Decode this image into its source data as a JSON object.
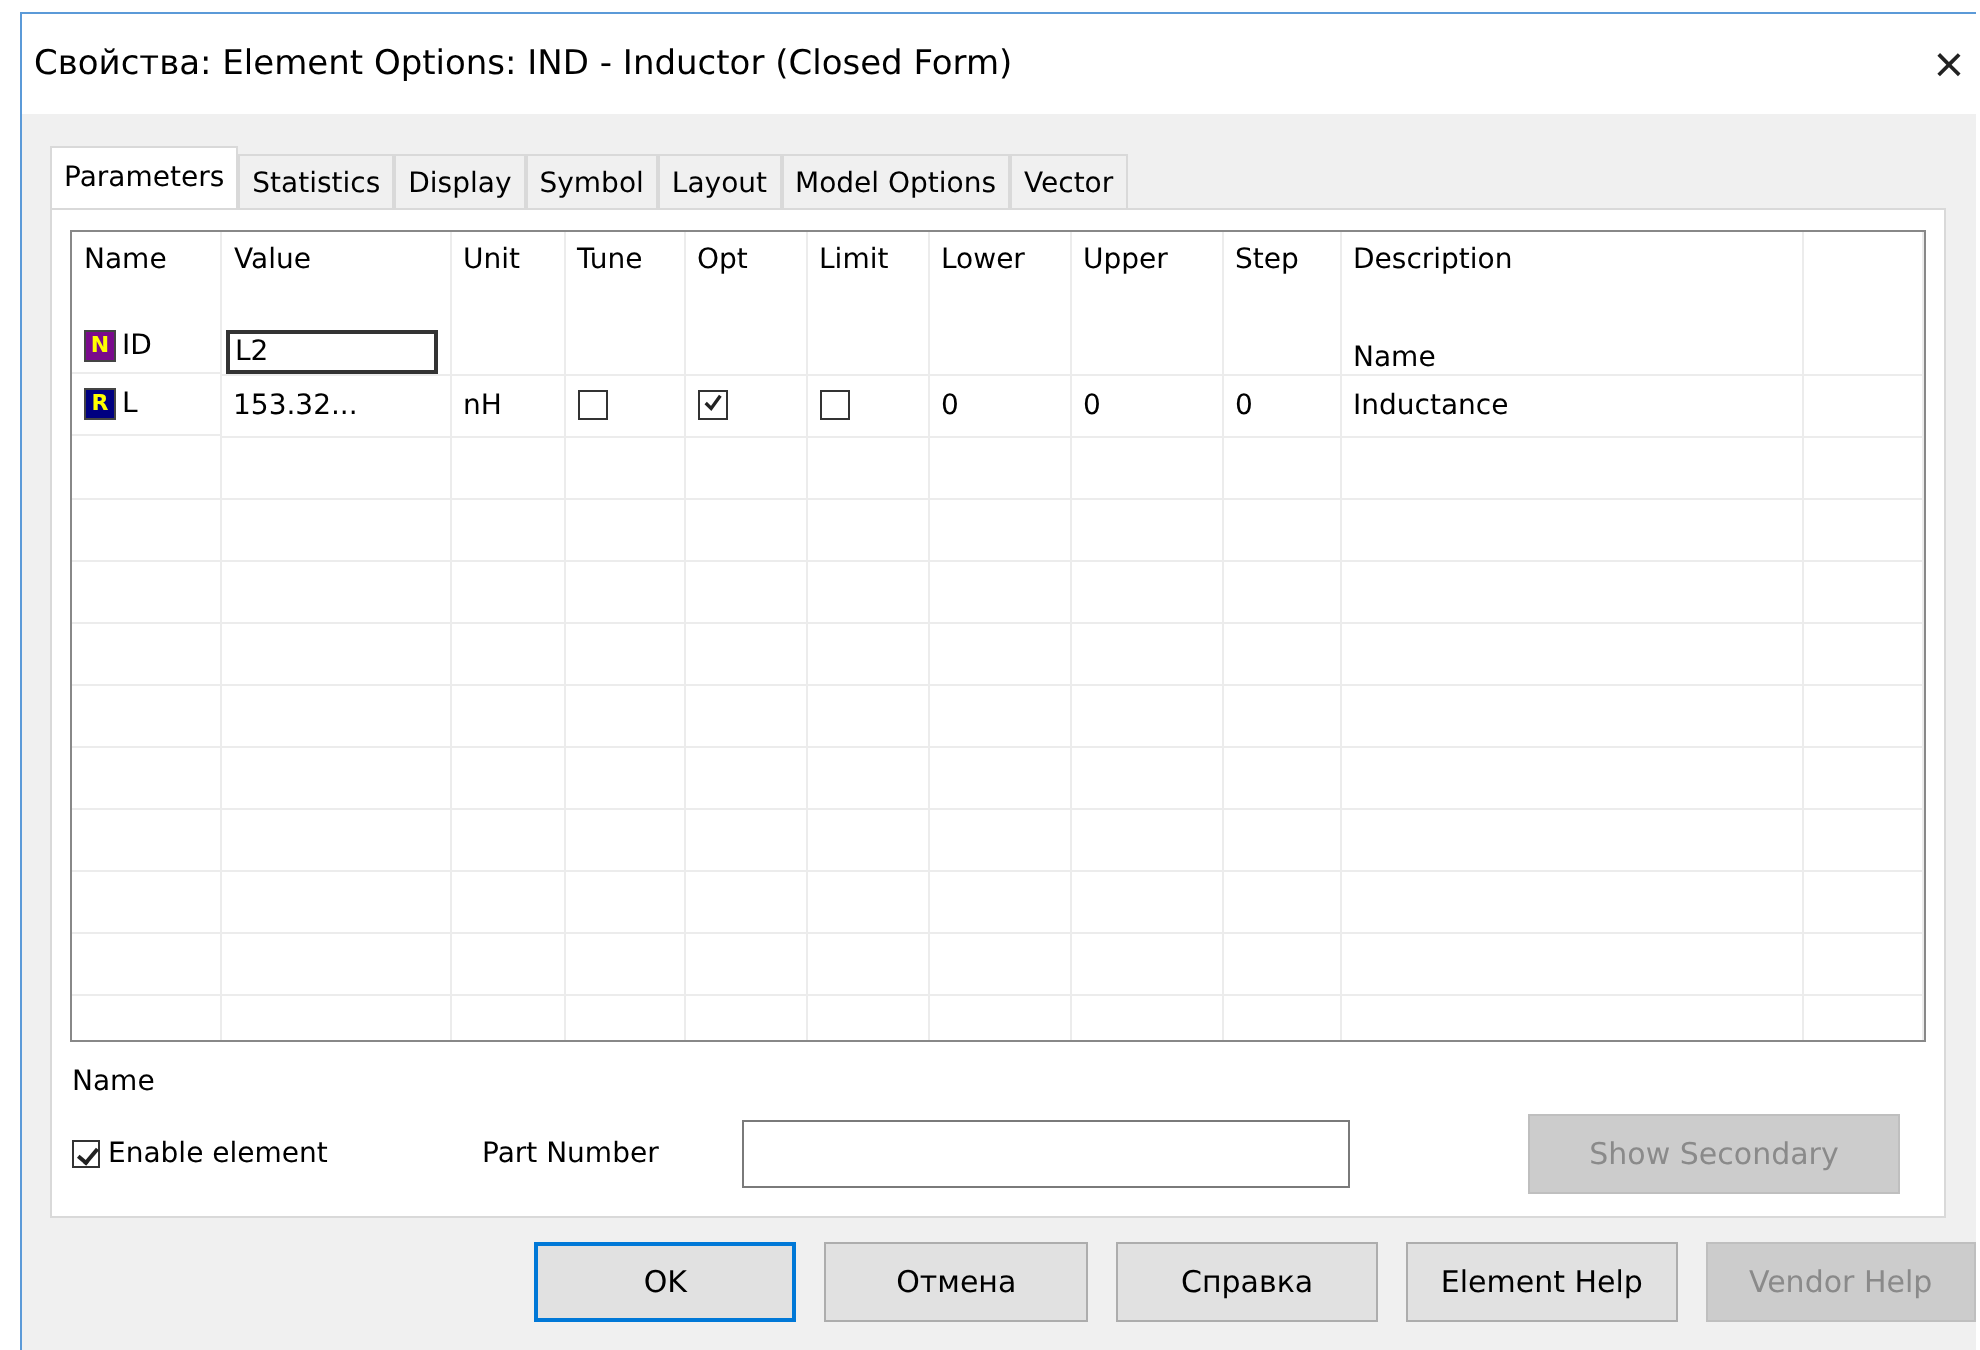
{
  "window": {
    "title": "Свойства: Element Options: IND - Inductor (Closed Form)",
    "close": "×"
  },
  "tabs": [
    {
      "label": "Parameters",
      "selected": true
    },
    {
      "label": "Statistics",
      "selected": false
    },
    {
      "label": "Display",
      "selected": false
    },
    {
      "label": "Symbol",
      "selected": false
    },
    {
      "label": "Layout",
      "selected": false
    },
    {
      "label": "Model Options",
      "selected": false
    },
    {
      "label": "Vector",
      "selected": false
    }
  ],
  "grid": {
    "columns": [
      "Name",
      "Value",
      "Unit",
      "Tune",
      "Opt",
      "Limit",
      "Lower",
      "Upper",
      "Step",
      "Description"
    ],
    "rows": [
      {
        "kind": "text",
        "badge": "N",
        "color": "#7a0a8c",
        "name": "ID",
        "value": "L2",
        "editing": true,
        "description": "Name"
      },
      {
        "kind": "param",
        "badge": "R",
        "color": "#000080",
        "name": "L",
        "value": "153.32...",
        "editing": false,
        "unit": "nH",
        "tune": false,
        "opt": true,
        "limit": false,
        "lower": "0",
        "upper": "0",
        "step": "0",
        "description": "Inductance"
      }
    ]
  },
  "selection_label": "Name",
  "enable_element": {
    "label": "Enable element",
    "checked": true
  },
  "part_number": {
    "label": "Part Number"
  },
  "show_secondary": {
    "label": "Show Secondary",
    "disabled": true
  },
  "buttons": [
    {
      "label": "OK",
      "default": true,
      "disabled": false
    },
    {
      "label": "Отмена",
      "default": false,
      "disabled": false
    },
    {
      "label": "Справка",
      "default": false,
      "disabled": false
    },
    {
      "label": "Element Help",
      "default": false,
      "disabled": false
    },
    {
      "label": "Vendor Help",
      "default": false,
      "disabled": true
    }
  ]
}
